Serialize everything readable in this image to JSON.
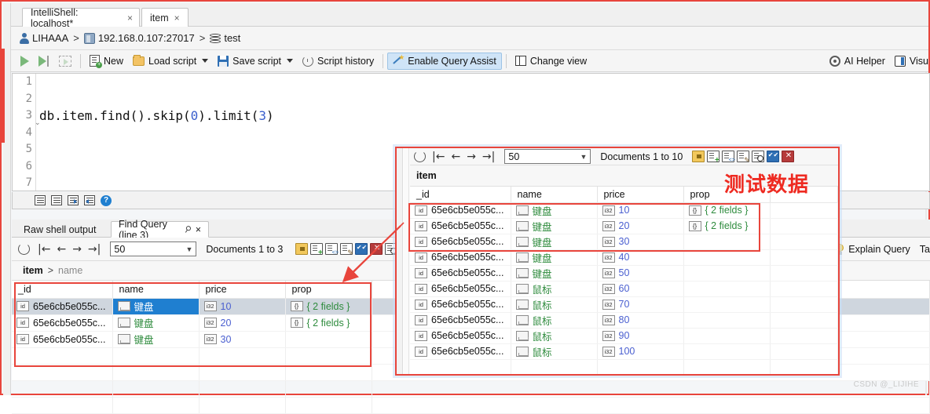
{
  "window": {
    "tabs": [
      {
        "label": "IntelliShell: localhost*",
        "close": "×",
        "active": true
      },
      {
        "label": "item",
        "close": "×",
        "active": false
      }
    ]
  },
  "breadcrumb": {
    "user": "LIHAAA",
    "sep1": ">",
    "server": "192.168.0.107:27017",
    "sep2": ">",
    "database": "test"
  },
  "toolbar": {
    "new": "New",
    "load_script": "Load script",
    "save_script": "Save script",
    "script_history": "Script history",
    "enable_query_assist": "Enable Query Assist",
    "change_view": "Change view",
    "ai_helper": "AI Helper",
    "visualize": "Visu"
  },
  "editor": {
    "line_numbers": [
      "1",
      "2",
      "3",
      "4",
      "5",
      "6",
      "7"
    ],
    "fold_marker": "⌄",
    "code_prefix": "db.item.find().skip(",
    "code_num1": "0",
    "code_mid": ").limit(",
    "code_num2": "3",
    "code_suffix": ")"
  },
  "result_tabs": [
    {
      "label": "Raw shell output",
      "active": false
    },
    {
      "label": "Find Query (line 3)",
      "pin": "⚲",
      "close": "×",
      "active": true
    }
  ],
  "result_toolbar": {
    "page_size": "50",
    "documents_label": "Documents 1 to 3",
    "explain_query": "Explain Query",
    "table_label": "Ta"
  },
  "result_breadcrumb": {
    "collection": "item",
    "chevron": ">",
    "field": "name"
  },
  "table": {
    "columns": [
      "_id",
      "name",
      "price",
      "prop"
    ],
    "rows": [
      {
        "id": "65e6cb5e055c...",
        "name": "键盘",
        "price": "10",
        "prop": "{ 2 fields }",
        "selected": true
      },
      {
        "id": "65e6cb5e055c...",
        "name": "键盘",
        "price": "20",
        "prop": "{ 2 fields }",
        "selected": false
      },
      {
        "id": "65e6cb5e055c...",
        "name": "键盘",
        "price": "30",
        "prop": "",
        "selected": false
      }
    ]
  },
  "overlay": {
    "page_size": "50",
    "documents_label": "Documents 1 to 10",
    "collection": "item",
    "annotation": "测试数据",
    "columns": [
      "_id",
      "name",
      "price",
      "prop"
    ],
    "rows": [
      {
        "id": "65e6cb5e055c...",
        "name": "键盘",
        "price": "10",
        "prop": "{ 2 fields }"
      },
      {
        "id": "65e6cb5e055c...",
        "name": "键盘",
        "price": "20",
        "prop": "{ 2 fields }"
      },
      {
        "id": "65e6cb5e055c...",
        "name": "键盘",
        "price": "30",
        "prop": ""
      },
      {
        "id": "65e6cb5e055c...",
        "name": "键盘",
        "price": "40",
        "prop": ""
      },
      {
        "id": "65e6cb5e055c...",
        "name": "键盘",
        "price": "50",
        "prop": ""
      },
      {
        "id": "65e6cb5e055c...",
        "name": "鼠标",
        "price": "60",
        "prop": ""
      },
      {
        "id": "65e6cb5e055c...",
        "name": "鼠标",
        "price": "70",
        "prop": ""
      },
      {
        "id": "65e6cb5e055c...",
        "name": "鼠标",
        "price": "80",
        "prop": ""
      },
      {
        "id": "65e6cb5e055c...",
        "name": "鼠标",
        "price": "90",
        "prop": ""
      },
      {
        "id": "65e6cb5e055c...",
        "name": "鼠标",
        "price": "100",
        "prop": ""
      }
    ]
  },
  "icon_labels": {
    "id_type": "id",
    "int_type": "i32",
    "obj_type": "{}"
  },
  "watermark": "CSDN @_LIJIHE",
  "colors": {
    "annotation_red": "#e8453c",
    "selection_blue": "#1f7fd0",
    "string_green": "#2e8b3d",
    "number_blue": "#4a5fd0",
    "toolbar_highlight": "#cfe4f7"
  }
}
